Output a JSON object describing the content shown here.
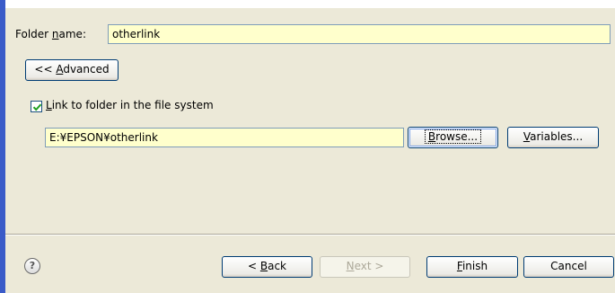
{
  "folder": {
    "label_pre": "Folder ",
    "label_accel": "n",
    "label_post": "ame:",
    "value": "otherlink"
  },
  "advanced_button": {
    "prefix": "<< ",
    "accel": "A",
    "rest": "dvanced"
  },
  "link": {
    "checked": true,
    "label_accel": "L",
    "label_rest": "ink to folder in the file system",
    "path_value": "E:¥EPSON¥otherlink",
    "browse_accel": "B",
    "browse_rest": "rowse...",
    "variables_accel": "V",
    "variables_rest": "ariables..."
  },
  "footer": {
    "help_icon": "help-icon",
    "help_glyph": "?",
    "back_prefix": "< ",
    "back_accel": "B",
    "back_rest": "ack",
    "next_accel": "N",
    "next_rest": "ext >",
    "finish_accel": "F",
    "finish_rest": "inish",
    "cancel_label": "Cancel"
  },
  "colors": {
    "accent": "#3a5bc8",
    "field_background": "#ffffcc",
    "dialog_background": "#ece9d8"
  }
}
